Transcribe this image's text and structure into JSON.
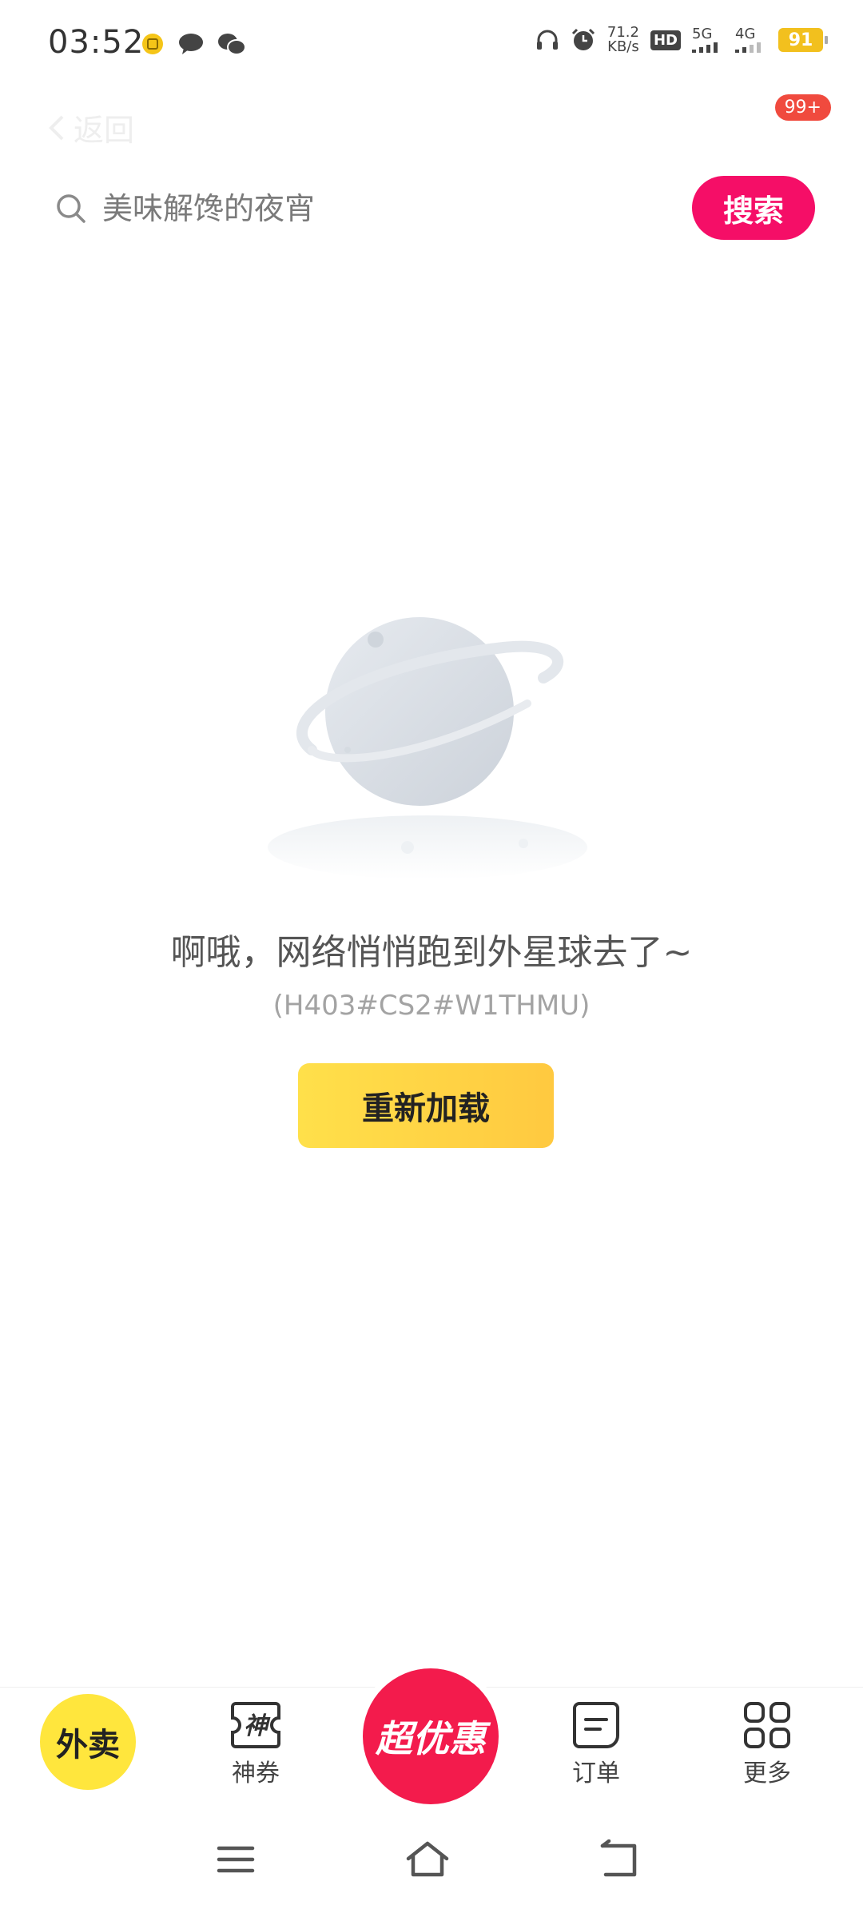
{
  "status_bar": {
    "time": "03:52",
    "net_speed_value": "71.2",
    "net_speed_unit": "KB/s",
    "hd_label": "HD",
    "sim1": "5G",
    "sim2": "4G",
    "battery": "91"
  },
  "top_nav": {
    "back_label": "返回",
    "badge": "99+"
  },
  "search": {
    "placeholder": "美味解馋的夜宵",
    "button_label": "搜索"
  },
  "error": {
    "title": "啊哦，网络悄悄跑到外星球去了~",
    "code": "(H403#CS2#W1THMU)",
    "reload_label": "重新加载"
  },
  "tab_bar": {
    "waimai_label": "外卖",
    "coupon_label": "神券",
    "coupon_icon_text": "神",
    "super_label": "超优惠",
    "orders_label": "订单",
    "more_label": "更多"
  },
  "colors": {
    "brand_yellow": "#ffe63d",
    "search_button": "#f50e67",
    "super_red": "#f31b4c",
    "badge_red": "#f04a3e"
  }
}
